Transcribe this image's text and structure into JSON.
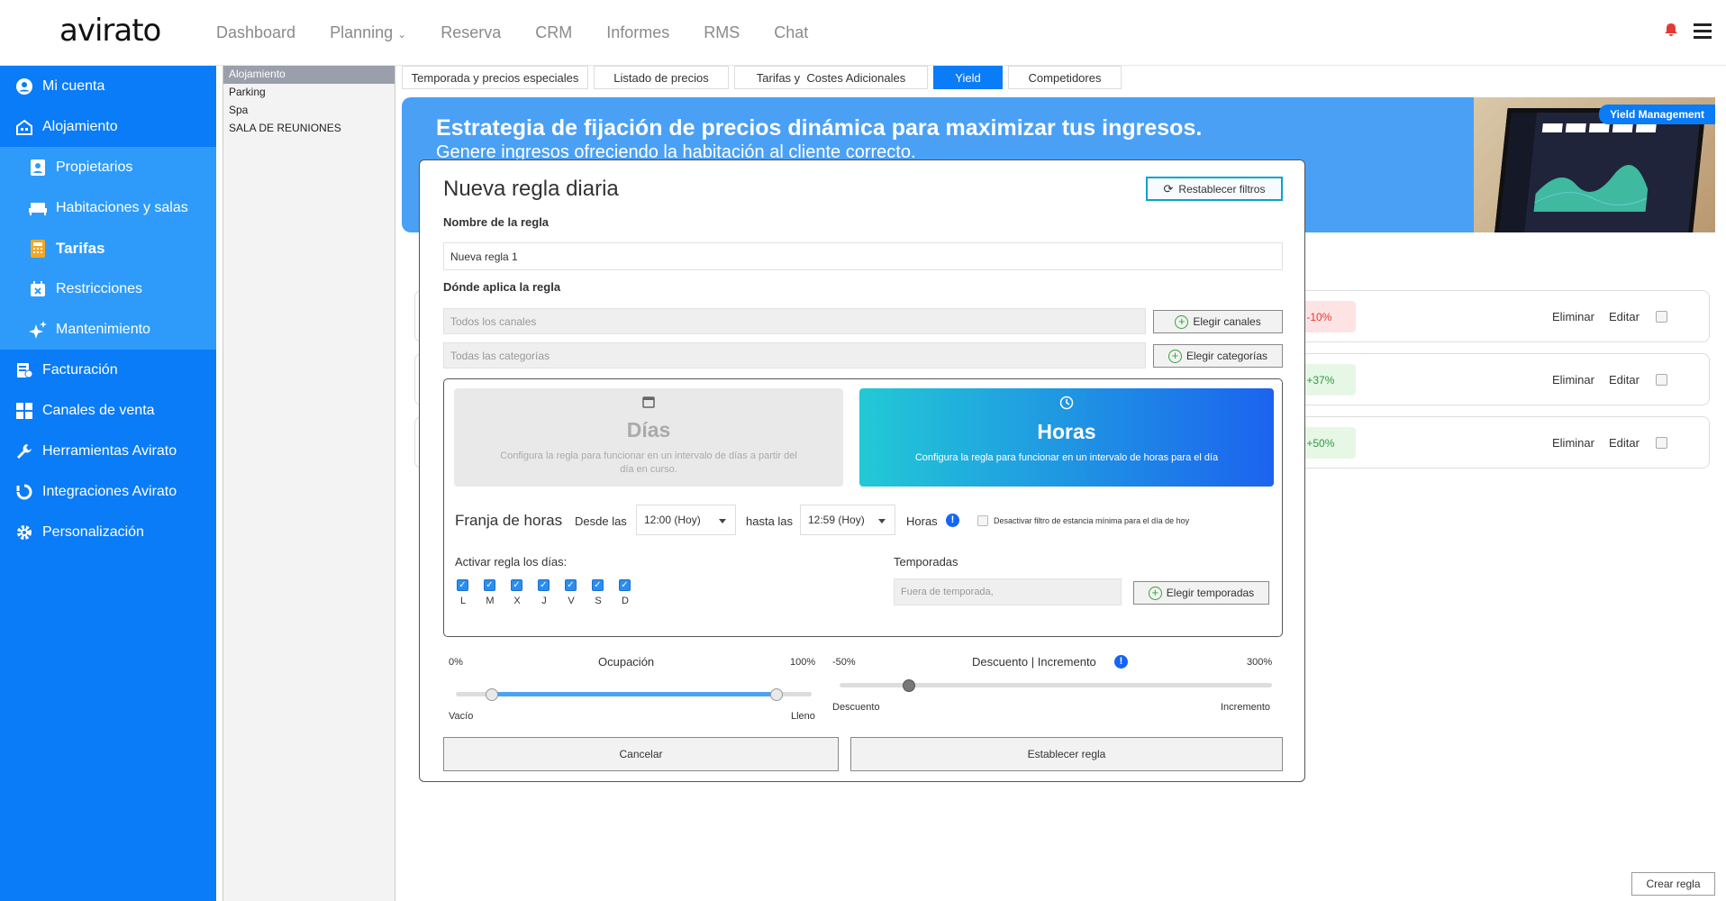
{
  "app": {
    "logo": "avirato"
  },
  "nav": [
    "Dashboard",
    "Planning",
    "Reserva",
    "CRM",
    "Informes",
    "RMS",
    "Chat"
  ],
  "sidebar": {
    "items": [
      {
        "label": "Mi cuenta",
        "icon": "user-icon"
      },
      {
        "label": "Alojamiento",
        "icon": "hotel-icon"
      },
      {
        "label": "Propietarios",
        "icon": "owner-icon"
      },
      {
        "label": "Habitaciones y salas",
        "icon": "bed-icon"
      },
      {
        "label": "Tarifas",
        "icon": "calculator-icon"
      },
      {
        "label": "Restricciones",
        "icon": "calendar-x-icon"
      },
      {
        "label": "Mantenimiento",
        "icon": "sparkle-icon"
      },
      {
        "label": "Facturación",
        "icon": "invoice-icon"
      },
      {
        "label": "Canales de venta",
        "icon": "grid-icon"
      },
      {
        "label": "Herramientas Avirato",
        "icon": "wrench-icon"
      },
      {
        "label": "Integraciones Avirato",
        "icon": "sync-icon"
      },
      {
        "label": "Personalización",
        "icon": "gear-icon"
      }
    ]
  },
  "categories": [
    "Alojamiento",
    "Parking",
    "Spa",
    "SALA DE REUNIONES"
  ],
  "tabs": [
    "Temporada y precios especiales",
    "Listado de precios",
    "Tarifas y  Costes Adicionales",
    "Yield",
    "Competidores"
  ],
  "banner": {
    "title": "Estrategia de fijación de precios dinámica para maximizar tus ingresos.",
    "subtitle": "Genere ingresos ofreciendo la habitación al cliente correcto.",
    "badge": "Yield Management"
  },
  "rules": [
    {
      "pct": "to -10%",
      "del": "Eliminar",
      "edit": "Editar",
      "color": "#fde3e3",
      "text": "#e53935"
    },
    {
      "pct": "to +37%",
      "del": "Eliminar",
      "edit": "Editar",
      "color": "#e6f7e6",
      "text": "#2e9b3e"
    },
    {
      "pct": "to +50%",
      "del": "Eliminar",
      "edit": "Editar",
      "color": "#e6f7e6",
      "text": "#2e9b3e"
    }
  ],
  "crear": "Crear regla",
  "modal": {
    "title": "Nueva regla diaria",
    "reset": "Restablecer filtros",
    "name_label": "Nombre de la regla",
    "name_value": "Nueva regla 1",
    "where_label": "Dónde aplica la regla",
    "channels_placeholder": "Todos los canales",
    "channels_btn": "Elegir canales",
    "cats_placeholder": "Todas las categorías",
    "cats_btn": "Elegir categorías",
    "dias_title": "Días",
    "dias_desc": "Configura la regla para funcionar en un intervalo de días a partir del día en curso.",
    "horas_title": "Horas",
    "horas_desc": "Configura la regla para funcionar en un intervalo de horas para el día",
    "franja": "Franja de horas",
    "desde": "Desde las",
    "desde_val": "12:00 (Hoy)",
    "hasta": "hasta las",
    "hasta_val": "12:59 (Hoy)",
    "horas_lbl": "Horas",
    "desactivar": "Desactivar filtro de estancia mínima para el día de hoy",
    "activar": "Activar regla los días:",
    "days": [
      "L",
      "M",
      "X",
      "J",
      "V",
      "S",
      "D"
    ],
    "temporadas": "Temporadas",
    "temp_placeholder": "Fuera de temporada,",
    "temp_btn": "Elegir temporadas",
    "occ_min": "0%",
    "occ_title": "Ocupación",
    "occ_max": "100%",
    "occ_low": "Vacío",
    "occ_high": "Lleno",
    "occ_range": [
      0.1,
      0.9
    ],
    "disc_min": "-50%",
    "disc_title": "Descuento | Incremento",
    "disc_max": "300%",
    "disc_low": "Descuento",
    "disc_high": "Incremento",
    "disc_value": 0,
    "cancel": "Cancelar",
    "submit": "Establecer regla"
  }
}
